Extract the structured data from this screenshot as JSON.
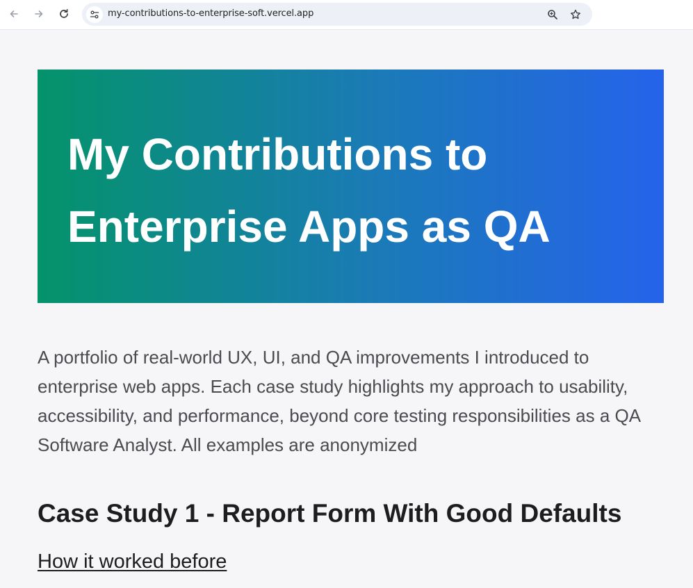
{
  "browser": {
    "url": "my-contributions-to-enterprise-soft.vercel.app",
    "icons": [
      "back-arrow-icon",
      "forward-arrow-icon",
      "reload-icon",
      "site-info-icon",
      "zoom-icon",
      "bookmark-star-icon"
    ]
  },
  "page": {
    "hero_title": "My Contributions to Enterprise Apps as QA",
    "hero_gradient": [
      "#04936a",
      "#2563eb"
    ],
    "intro": "A portfolio of real-world UX, UI, and QA improvements I introduced to enterprise web apps. Each case study highlights my approach to usability, accessibility, and performance, beyond core testing responsibilities as a QA Software Analyst. All examples are anonymized",
    "case_study_title": "Case Study 1 - Report Form With Good Defaults",
    "section_link": "How it worked before"
  }
}
